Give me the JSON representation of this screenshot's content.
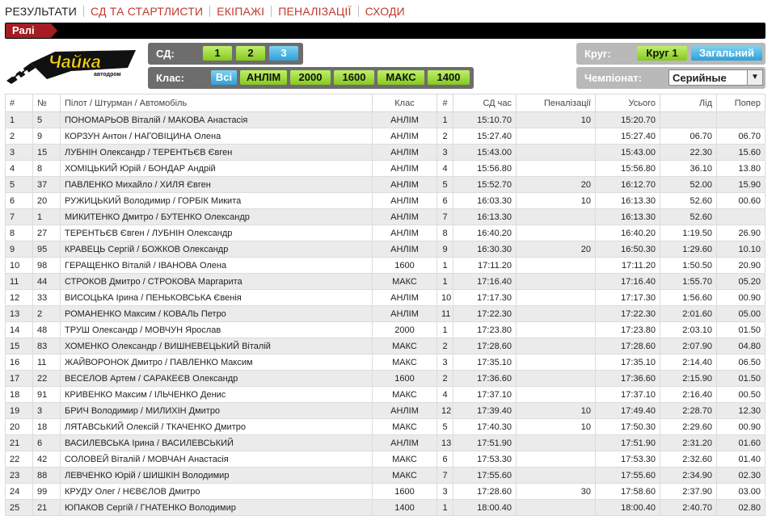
{
  "nav": {
    "items": [
      "РЕЗУЛЬТАТИ",
      "СД ТА СТАРТЛИСТИ",
      "ЕКІПАЖІ",
      "ПЕНАЛІЗАЦІЇ",
      "СХОДИ"
    ]
  },
  "section_tag": "Ралі",
  "logo": {
    "text": "Чайка",
    "subtext": "автодром"
  },
  "filters": {
    "sd_label": "СД:",
    "sd_buttons": [
      "1",
      "2",
      "3"
    ],
    "sd_active": "3",
    "class_label": "Клас:",
    "class_buttons": [
      "Всі",
      "АНЛІМ",
      "2000",
      "1600",
      "МАКС",
      "1400"
    ],
    "class_active": "Всі",
    "lap_label": "Круг:",
    "lap_buttons": [
      "Круг 1",
      "Загальний"
    ],
    "lap_active": "Загальний",
    "championship_label": "Чемпіонат:",
    "championship_value": "Серийные"
  },
  "table": {
    "headers": [
      "#",
      "№",
      "Пілот / Штурман / Автомобіль",
      "Клас",
      "#",
      "СД час",
      "Пеналізації",
      "Усього",
      "Лід",
      "Попер"
    ],
    "rows": [
      [
        "1",
        "5",
        "ПОНОМАРЬОВ Віталій / МАКОВА Анастасія",
        "АНЛІМ",
        "1",
        "15:10.70",
        "10",
        "15:20.70",
        "",
        ""
      ],
      [
        "2",
        "9",
        "КОРЗУН Антон / НАГОВІЦИНА Олена",
        "АНЛІМ",
        "2",
        "15:27.40",
        "",
        "15:27.40",
        "06.70",
        "06.70"
      ],
      [
        "3",
        "15",
        "ЛУБНІН Олександр / ТЕРЕНТЬЄВ Євген",
        "АНЛІМ",
        "3",
        "15:43.00",
        "",
        "15:43.00",
        "22.30",
        "15.60"
      ],
      [
        "4",
        "8",
        "ХОМІЦЬКИЙ Юрій / БОНДАР Андрій",
        "АНЛІМ",
        "4",
        "15:56.80",
        "",
        "15:56.80",
        "36.10",
        "13.80"
      ],
      [
        "5",
        "37",
        "ПАВЛЕНКО Михайло / ХИЛЯ Євген",
        "АНЛІМ",
        "5",
        "15:52.70",
        "20",
        "16:12.70",
        "52.00",
        "15.90"
      ],
      [
        "6",
        "20",
        "РУЖИЦЬКИЙ Володимир / ГОРБІК Микита",
        "АНЛІМ",
        "6",
        "16:03.30",
        "10",
        "16:13.30",
        "52.60",
        "00.60"
      ],
      [
        "7",
        "1",
        "МИКИТЕНКО Дмитро / БУТЕНКО Олександр",
        "АНЛІМ",
        "7",
        "16:13.30",
        "",
        "16:13.30",
        "52.60",
        ""
      ],
      [
        "8",
        "27",
        "ТЕРЕНТЬЄВ Євген / ЛУБНІН Олександр",
        "АНЛІМ",
        "8",
        "16:40.20",
        "",
        "16:40.20",
        "1:19.50",
        "26.90"
      ],
      [
        "9",
        "95",
        "КРАВЕЦЬ Сергій / БОЖКОВ Олександр",
        "АНЛІМ",
        "9",
        "16:30.30",
        "20",
        "16:50.30",
        "1:29.60",
        "10.10"
      ],
      [
        "10",
        "98",
        "ГЕРАЩЕНКО Віталій / ІВАНОВА Олена",
        "1600",
        "1",
        "17:11.20",
        "",
        "17:11.20",
        "1:50.50",
        "20.90"
      ],
      [
        "11",
        "44",
        "СТРОКОВ Дмитро / СТРОКОВА Маргарита",
        "МАКС",
        "1",
        "17:16.40",
        "",
        "17:16.40",
        "1:55.70",
        "05.20"
      ],
      [
        "12",
        "33",
        "ВИСОЦЬКА Ірина / ПЕНЬКОВСЬКА Євенія",
        "АНЛІМ",
        "10",
        "17:17.30",
        "",
        "17:17.30",
        "1:56.60",
        "00.90"
      ],
      [
        "13",
        "2",
        "РОМАНЕНКО Максим / КОВАЛЬ Петро",
        "АНЛІМ",
        "11",
        "17:22.30",
        "",
        "17:22.30",
        "2:01.60",
        "05.00"
      ],
      [
        "14",
        "48",
        "ТРУШ Олександр / МОВЧУН Ярослав",
        "2000",
        "1",
        "17:23.80",
        "",
        "17:23.80",
        "2:03.10",
        "01.50"
      ],
      [
        "15",
        "83",
        "ХОМЕНКО Олександр / ВИШНЕВЕЦЬКИЙ Віталій",
        "МАКС",
        "2",
        "17:28.60",
        "",
        "17:28.60",
        "2:07.90",
        "04.80"
      ],
      [
        "16",
        "11",
        "ЖАЙВОРОНОК Дмитро / ПАВЛЕНКО Максим",
        "МАКС",
        "3",
        "17:35.10",
        "",
        "17:35.10",
        "2:14.40",
        "06.50"
      ],
      [
        "17",
        "22",
        "ВЕСЕЛОВ Артем / САРАКЕЄВ Олександр",
        "1600",
        "2",
        "17:36.60",
        "",
        "17:36.60",
        "2:15.90",
        "01.50"
      ],
      [
        "18",
        "91",
        "КРИВЕНКО Максим / ІЛЬЧЕНКО Денис",
        "МАКС",
        "4",
        "17:37.10",
        "",
        "17:37.10",
        "2:16.40",
        "00.50"
      ],
      [
        "19",
        "3",
        "БРИЧ Володимир / МИЛИХІН Дмитро",
        "АНЛІМ",
        "12",
        "17:39.40",
        "10",
        "17:49.40",
        "2:28.70",
        "12.30"
      ],
      [
        "20",
        "18",
        "ЛЯТАВСЬКИЙ Олексій / ТКАЧЕНКО Дмитро",
        "МАКС",
        "5",
        "17:40.30",
        "10",
        "17:50.30",
        "2:29.60",
        "00.90"
      ],
      [
        "21",
        "6",
        "ВАСИЛЕВСЬКА Ірина / ВАСИЛЕВСЬКИЙ",
        "АНЛІМ",
        "13",
        "17:51.90",
        "",
        "17:51.90",
        "2:31.20",
        "01.60"
      ],
      [
        "22",
        "42",
        "СОЛОВЕЙ Віталій / МОВЧАН Анастасія",
        "МАКС",
        "6",
        "17:53.30",
        "",
        "17:53.30",
        "2:32.60",
        "01.40"
      ],
      [
        "23",
        "88",
        "ЛЕВЧЕНКО Юрій / ШИШКІН Володимир",
        "МАКС",
        "7",
        "17:55.60",
        "",
        "17:55.60",
        "2:34.90",
        "02.30"
      ],
      [
        "24",
        "99",
        "КРУДУ Олег / НЄВЄЛОВ Дмитро",
        "1600",
        "3",
        "17:28.60",
        "30",
        "17:58.60",
        "2:37.90",
        "03.00"
      ],
      [
        "25",
        "21",
        "ЮПАКОВ Сергій / ГНАТЕНКО Володимир",
        "1400",
        "1",
        "18:00.40",
        "",
        "18:00.40",
        "2:40.70",
        "02.80"
      ]
    ]
  }
}
